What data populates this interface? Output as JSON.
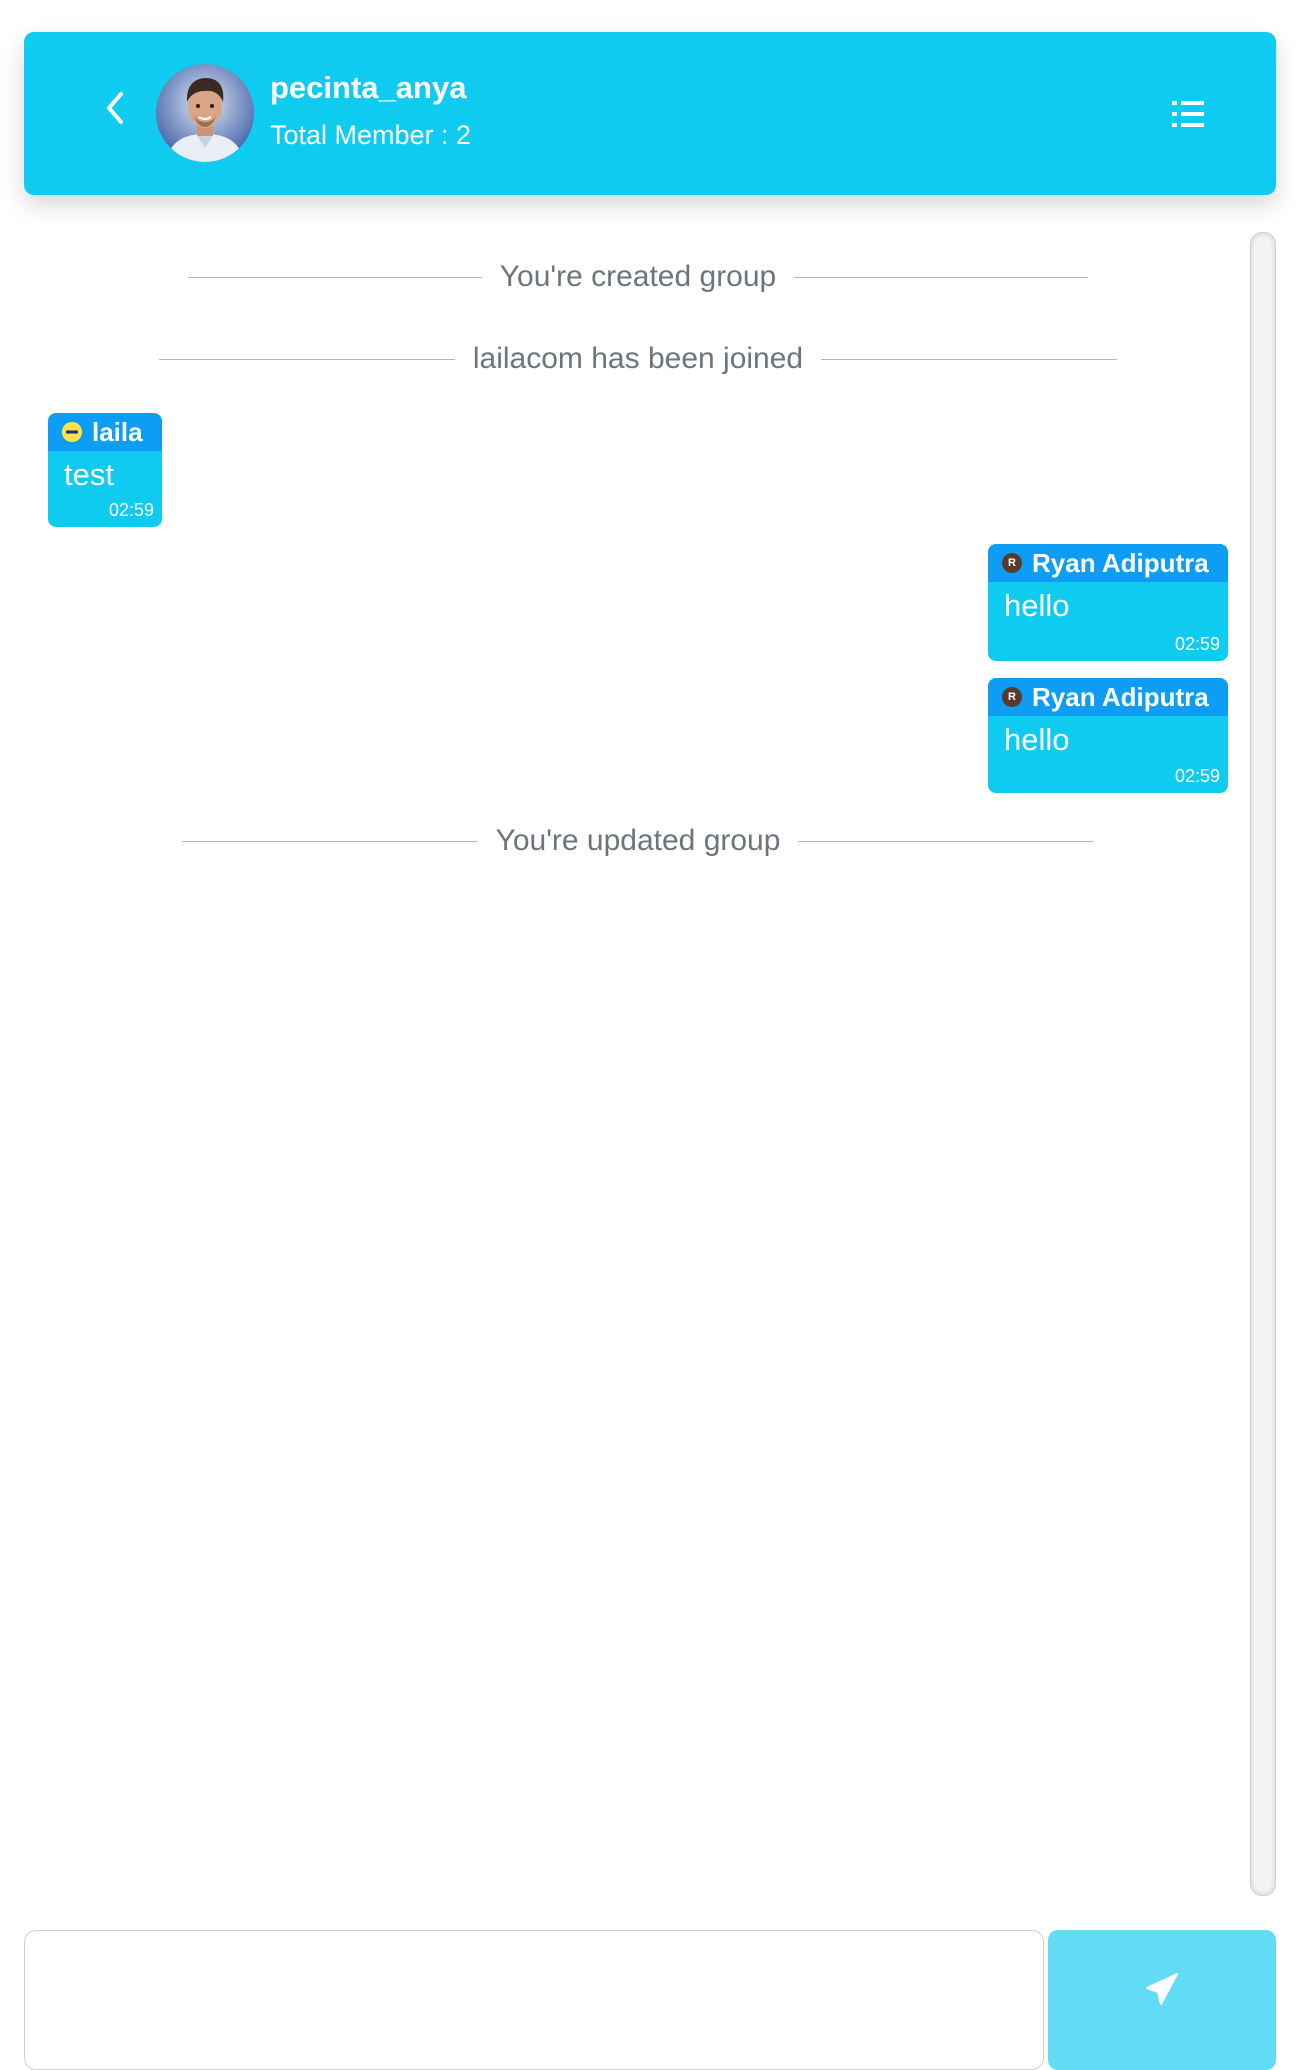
{
  "header": {
    "title": "pecinta_anya",
    "subtitle": "Total Member : 2",
    "back_icon": "chevron-left-icon",
    "menu_icon": "list-icon",
    "avatar": "group-avatar-photo"
  },
  "events": [
    {
      "text": "You're created group"
    },
    {
      "text": "lailacom has been joined"
    },
    {
      "text": "You're updated group"
    }
  ],
  "messages": [
    {
      "sender": "laila",
      "text": "test",
      "time": "02:59",
      "side": "left",
      "avatar_color": "#f5d800"
    },
    {
      "sender": "Ryan Adiputra",
      "text": "hello",
      "time": "02:59",
      "side": "right",
      "avatar_color": "#5a3a2c",
      "avatar_letter": "R"
    },
    {
      "sender": "Ryan Adiputra",
      "text": "hello",
      "time": "02:59",
      "side": "right",
      "avatar_color": "#5a3a2c",
      "avatar_letter": "R"
    }
  ],
  "composer": {
    "placeholder": "",
    "send_icon": "paper-plane-icon"
  },
  "colors": {
    "accent": "#10cbf0",
    "name_bar": "#0d9df5",
    "send_button": "#62dcf5"
  }
}
